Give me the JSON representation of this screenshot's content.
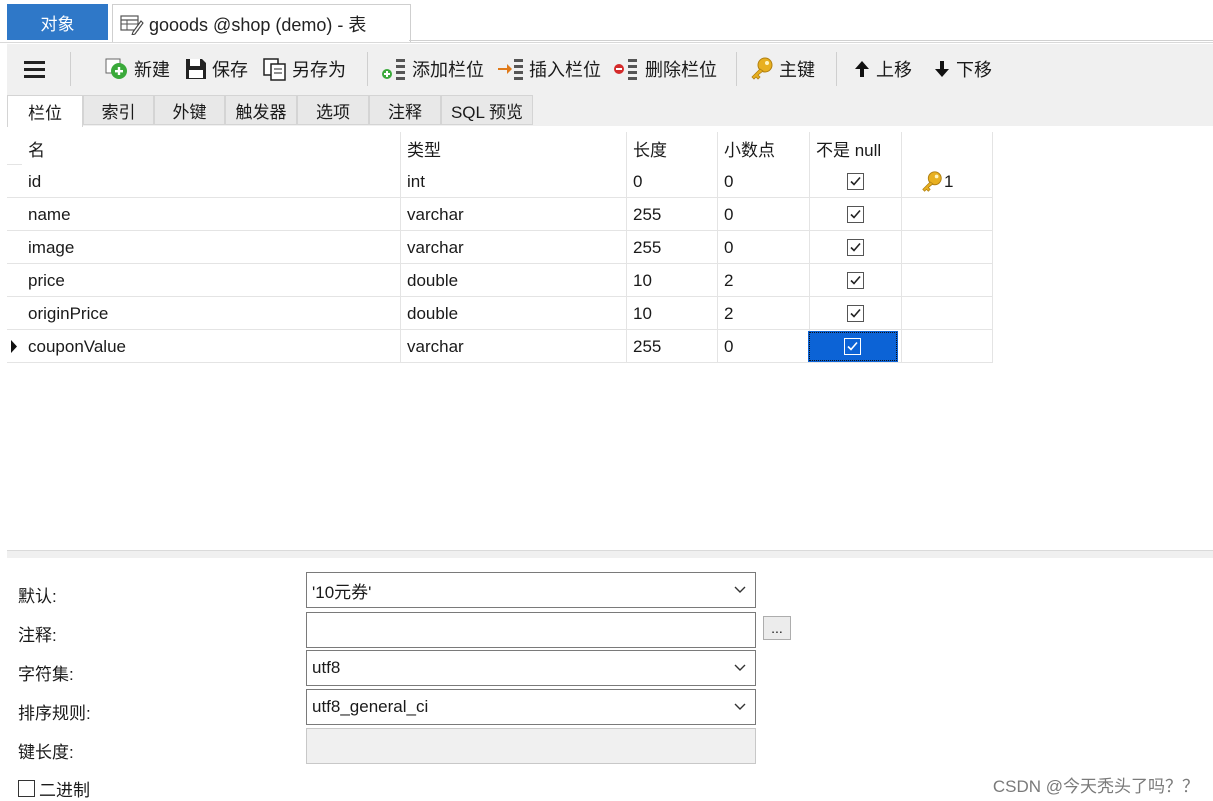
{
  "tabs": {
    "objects": "对象",
    "document": "gooods @shop (demo) - 表"
  },
  "toolbar": {
    "new": "新建",
    "save": "保存",
    "save_as": "另存为",
    "add_field": "添加栏位",
    "insert_field": "插入栏位",
    "delete_field": "删除栏位",
    "primary_key": "主键",
    "move_up": "上移",
    "move_down": "下移"
  },
  "subtabs": [
    "栏位",
    "索引",
    "外键",
    "触发器",
    "选项",
    "注释",
    "SQL 预览"
  ],
  "grid": {
    "headers": [
      "名",
      "类型",
      "长度",
      "小数点",
      "不是 null"
    ],
    "rows": [
      {
        "name": "id",
        "type": "int",
        "length": "0",
        "decimals": "0",
        "not_null": true,
        "key": "1"
      },
      {
        "name": "name",
        "type": "varchar",
        "length": "255",
        "decimals": "0",
        "not_null": true,
        "key": ""
      },
      {
        "name": "image",
        "type": "varchar",
        "length": "255",
        "decimals": "0",
        "not_null": true,
        "key": ""
      },
      {
        "name": "price",
        "type": "double",
        "length": "10",
        "decimals": "2",
        "not_null": true,
        "key": ""
      },
      {
        "name": "originPrice",
        "type": "double",
        "length": "10",
        "decimals": "2",
        "not_null": true,
        "key": ""
      },
      {
        "name": "couponValue",
        "type": "varchar",
        "length": "255",
        "decimals": "0",
        "not_null": true,
        "key": ""
      }
    ]
  },
  "props": {
    "default_label": "默认:",
    "default_value": "'10元券'",
    "comment_label": "注释:",
    "comment_value": "",
    "comment_button": "...",
    "charset_label": "字符集:",
    "charset_value": "utf8",
    "collation_label": "排序规则:",
    "collation_value": "utf8_general_ci",
    "key_length_label": "键长度:",
    "key_length_value": "",
    "binary_label": "二进制"
  },
  "watermark": "CSDN @今天秃头了吗？？",
  "colors": {
    "accent": "#2f78c8",
    "selection": "#0c63d6",
    "key": "#e0a820"
  }
}
